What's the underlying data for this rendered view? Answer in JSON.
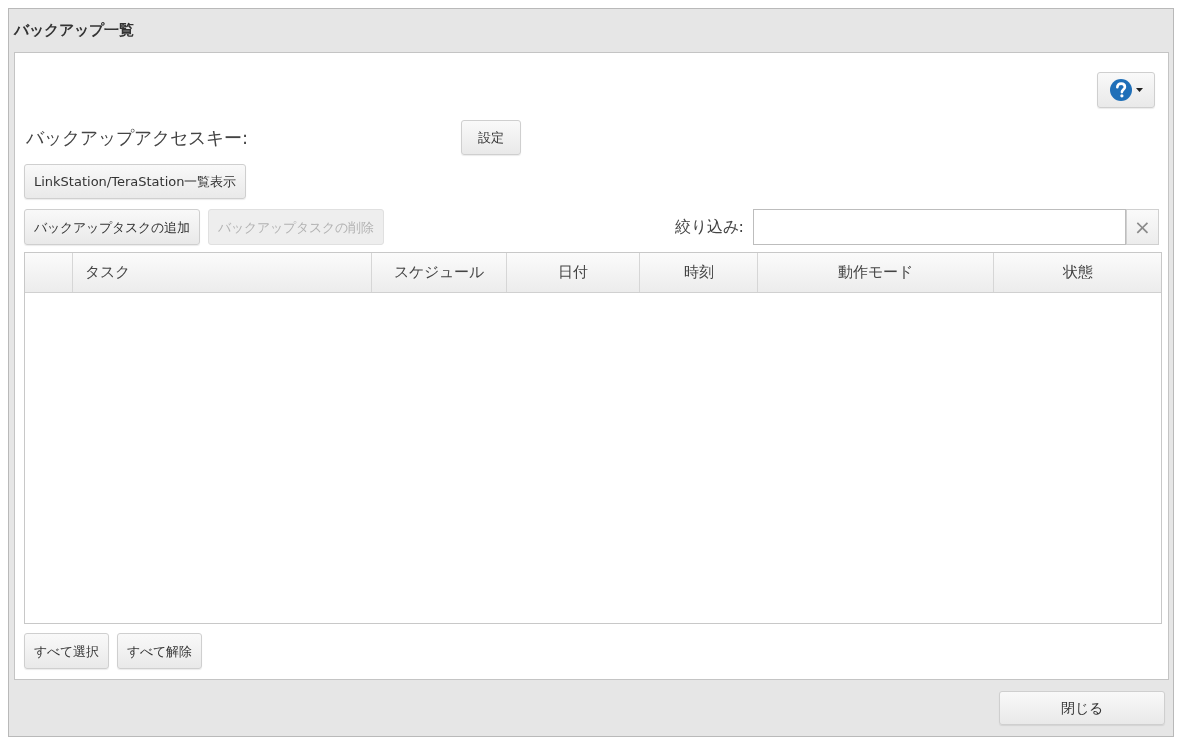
{
  "window": {
    "title": "バックアップ一覧"
  },
  "access_key": {
    "label": "バックアップアクセスキー:",
    "button": "設定"
  },
  "list_button": "LinkStation/TeraStation一覧表示",
  "task_buttons": [
    {
      "label": "バックアップタスクの追加",
      "disabled": false
    },
    {
      "label": "バックアップタスクの削除",
      "disabled": true
    }
  ],
  "filter": {
    "label": "絞り込み:",
    "clear": "×"
  },
  "table": {
    "columns": [
      "タスク",
      "スケジュール",
      "日付",
      "時刻",
      "動作モード",
      "状態"
    ]
  },
  "selection_buttons": [
    "すべて選択",
    "すべて解除"
  ],
  "footer": {
    "close_button": "閉じる"
  }
}
